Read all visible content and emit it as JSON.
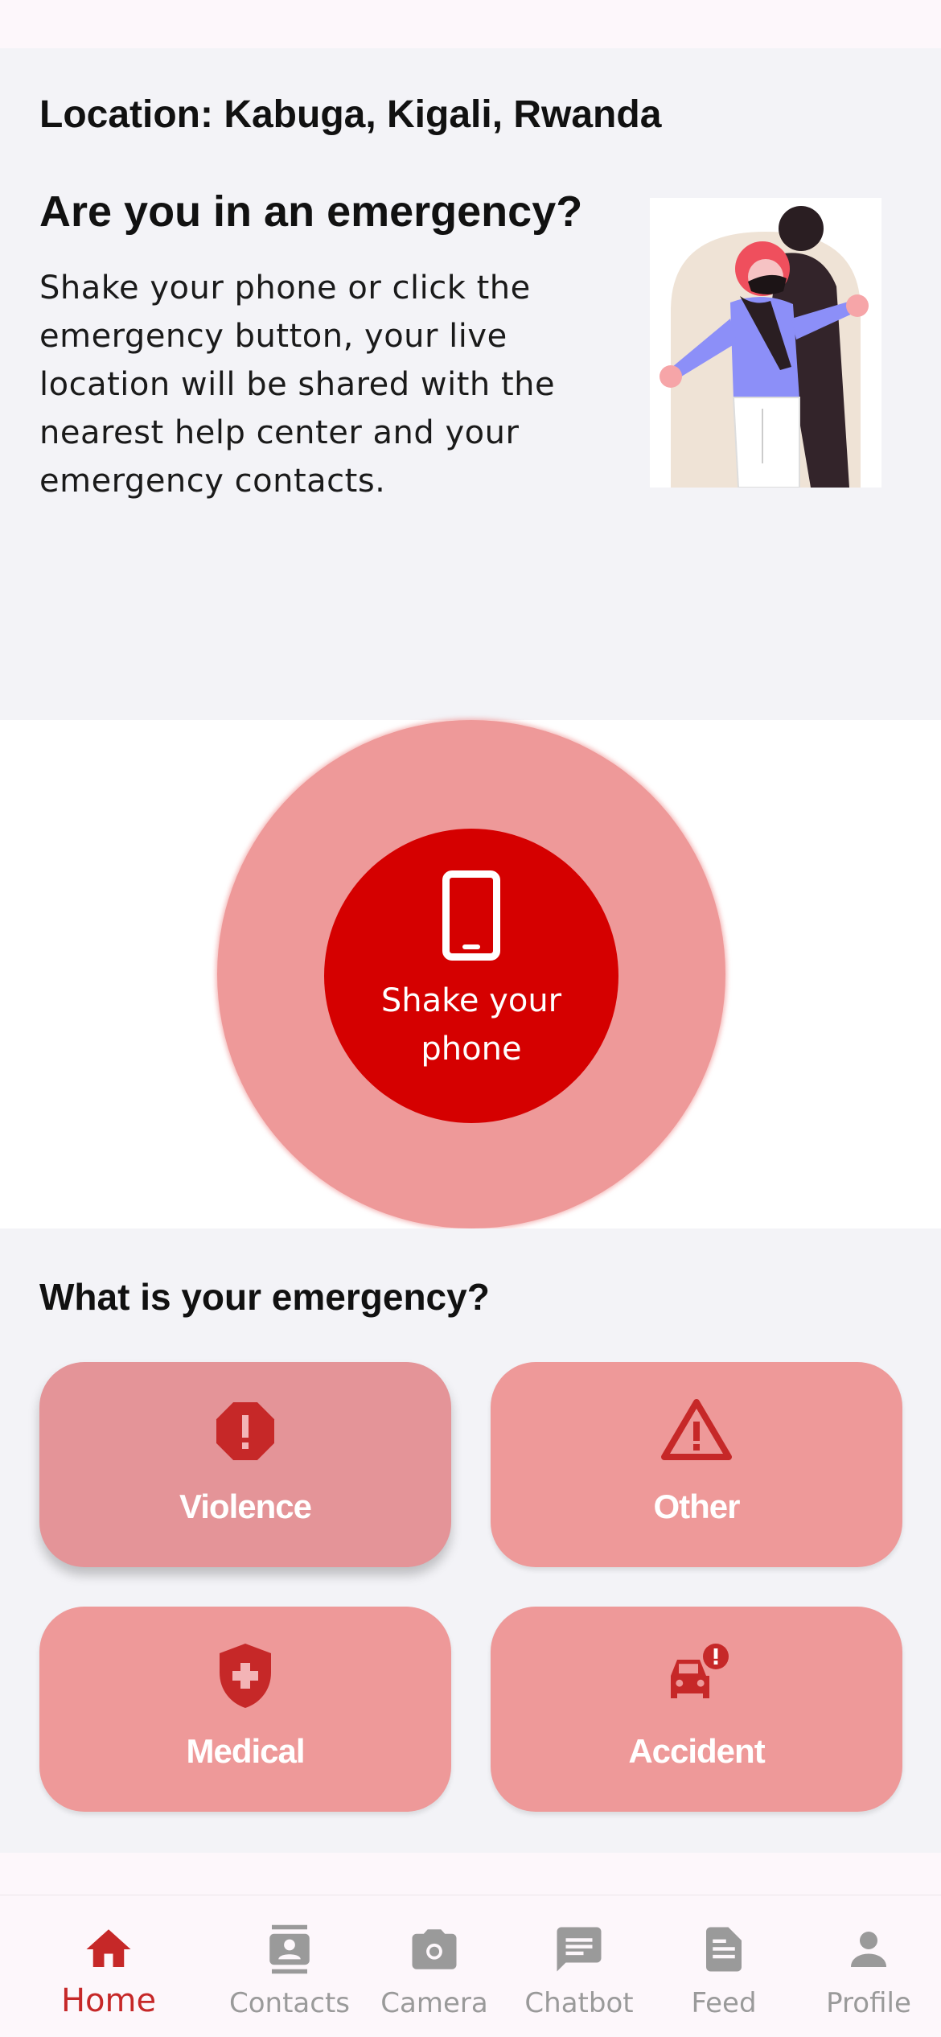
{
  "location": {
    "text": "Location: Kabuga, Kigali, Rwanda"
  },
  "intro": {
    "question": "Are you in an emergency?",
    "description": "Shake your phone or click the emergency button, your live location will be shared with the nearest help center and your emergency contacts."
  },
  "shake": {
    "label": "Shake your phone",
    "icon": "smartphone-icon"
  },
  "emergency": {
    "title": "What is your emergency?",
    "types": [
      {
        "label": "Violence",
        "icon": "report-octagon-icon"
      },
      {
        "label": "Other",
        "icon": "warning-triangle-icon"
      },
      {
        "label": "Medical",
        "icon": "medical-shield-icon"
      },
      {
        "label": "Accident",
        "icon": "car-crash-icon"
      }
    ]
  },
  "nav": {
    "items": [
      {
        "label": "Home",
        "icon": "home-icon",
        "active": true
      },
      {
        "label": "Contacts",
        "icon": "contacts-icon",
        "active": false
      },
      {
        "label": "Camera",
        "icon": "camera-icon",
        "active": false
      },
      {
        "label": "Chatbot",
        "icon": "chat-icon",
        "active": false
      },
      {
        "label": "Feed",
        "icon": "article-icon",
        "active": false
      },
      {
        "label": "Profile",
        "icon": "person-icon",
        "active": false
      }
    ]
  },
  "colors": {
    "primary_red": "#d50000",
    "accent_red": "#c62828",
    "card_pink": "#ee9999",
    "outer_circle": "#ee9999",
    "inactive_nav": "#9a9a9a"
  }
}
